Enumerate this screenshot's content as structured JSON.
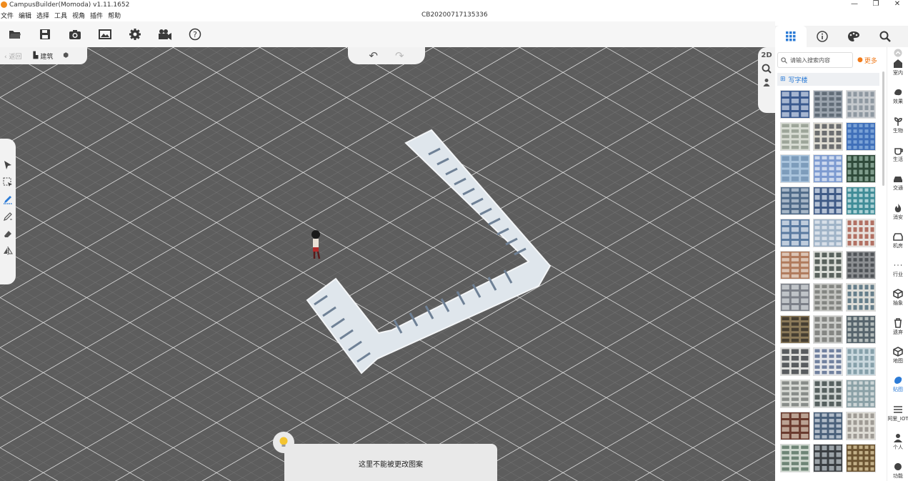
{
  "window": {
    "title": "CampusBuilder(Momoda) v1.11.1652",
    "controls": [
      "—",
      "❐",
      "✕"
    ]
  },
  "menu": [
    "文件",
    "编辑",
    "选择",
    "工具",
    "视角",
    "插件",
    "帮助"
  ],
  "document_id": "CB20200717135336",
  "toolbar": [
    {
      "name": "open-folder-icon"
    },
    {
      "name": "save-icon"
    },
    {
      "name": "camera-icon"
    },
    {
      "name": "image-icon"
    },
    {
      "name": "gear-icon"
    },
    {
      "name": "video-icon"
    },
    {
      "name": "help-icon"
    }
  ],
  "nav": {
    "back": "返回",
    "building": "建筑"
  },
  "view_tools": {
    "mode": "2D"
  },
  "tip": {
    "message": "这里不能被更改图案"
  },
  "panel": {
    "tabs": [
      "grid-icon",
      "info-icon",
      "palette-icon",
      "search-icon"
    ],
    "search_placeholder": "请输入搜索内容",
    "more": "更多",
    "category": "写字楼",
    "accent": "#2c7bd6",
    "more_color": "#f07a1a"
  },
  "thumbnails": [
    {
      "base": "#3b5a8e",
      "line": "#c9d4e6"
    },
    {
      "base": "#9aa3ad",
      "line": "#4d5a66"
    },
    {
      "base": "#c5c9cd",
      "line": "#7b8791"
    },
    {
      "base": "#d7dbd2",
      "line": "#8a9386"
    },
    {
      "base": "#dedbd1",
      "line": "#454a4f"
    },
    {
      "base": "#3f6fb9",
      "line": "#8fb3e0"
    },
    {
      "base": "#a9c3dc",
      "line": "#6f8fb0"
    },
    {
      "base": "#7c9ad0",
      "line": "#e8eef8"
    },
    {
      "base": "#2f4a3a",
      "line": "#9bb8a8"
    },
    {
      "base": "#4f6a88",
      "line": "#c2cfdb"
    },
    {
      "base": "#3f5a86",
      "line": "#dbe3ee"
    },
    {
      "base": "#3f8c97",
      "line": "#d2e8ea"
    },
    {
      "base": "#5a7aa0",
      "line": "#e1e8f0"
    },
    {
      "base": "#9fb3c7",
      "line": "#e9eef3"
    },
    {
      "base": "#e7e2de",
      "line": "#a04a3a"
    },
    {
      "base": "#b07a5c",
      "line": "#e9ddd2"
    },
    {
      "base": "#d9dcd6",
      "line": "#2e3a34"
    },
    {
      "base": "#8c8f92",
      "line": "#3b3f43"
    },
    {
      "base": "#7c8088",
      "line": "#d6d9dc"
    },
    {
      "base": "#c3c4c0",
      "line": "#6d706c"
    },
    {
      "base": "#dcdcd7",
      "line": "#3f5f72"
    },
    {
      "base": "#8b7a5a",
      "line": "#2d2b26"
    },
    {
      "base": "#c9cac7",
      "line": "#6d6f6c"
    },
    {
      "base": "#56646c",
      "line": "#d4d8d4"
    },
    {
      "base": "#dcdcd9",
      "line": "#2d3135"
    },
    {
      "base": "#e6e7ea",
      "line": "#4a5f86"
    },
    {
      "base": "#c9d8de",
      "line": "#6f8d98"
    },
    {
      "base": "#d7d9d4",
      "line": "#6d7270"
    },
    {
      "base": "#cdd2d0",
      "line": "#2e3a3a"
    },
    {
      "base": "#8aa0a6",
      "line": "#e2e7e6"
    },
    {
      "base": "#6a3a2e",
      "line": "#d7c5b6"
    },
    {
      "base": "#4a607a",
      "line": "#d3dae3"
    },
    {
      "base": "#dddbd4",
      "line": "#8a8680"
    },
    {
      "base": "#cfd8cf",
      "line": "#4e6a58"
    },
    {
      "base": "#3a3e42",
      "line": "#bcc4ca"
    },
    {
      "base": "#6b5432",
      "line": "#e0cfa5"
    }
  ],
  "rail": [
    {
      "icon": "house-icon",
      "label": "室内"
    },
    {
      "icon": "effects-icon",
      "label": "效果"
    },
    {
      "icon": "plant-icon",
      "label": "生物"
    },
    {
      "icon": "cup-icon",
      "label": "生活"
    },
    {
      "icon": "car-icon",
      "label": "交通"
    },
    {
      "icon": "fire-icon",
      "label": "消安"
    },
    {
      "icon": "server-icon",
      "label": "机房"
    },
    {
      "icon": "more-icon",
      "label": "行业"
    },
    {
      "icon": "cube-outline-icon",
      "label": "抽象"
    },
    {
      "icon": "trash-icon",
      "label": "遗弃"
    },
    {
      "icon": "cube-icon",
      "label": "地图"
    },
    {
      "icon": "paint-icon",
      "label": "贴图",
      "active": true
    },
    {
      "icon": "list-icon",
      "label": "阿里_IOT"
    },
    {
      "icon": "person-icon",
      "label": "个人"
    },
    {
      "icon": "function-icon",
      "label": "功能"
    }
  ]
}
